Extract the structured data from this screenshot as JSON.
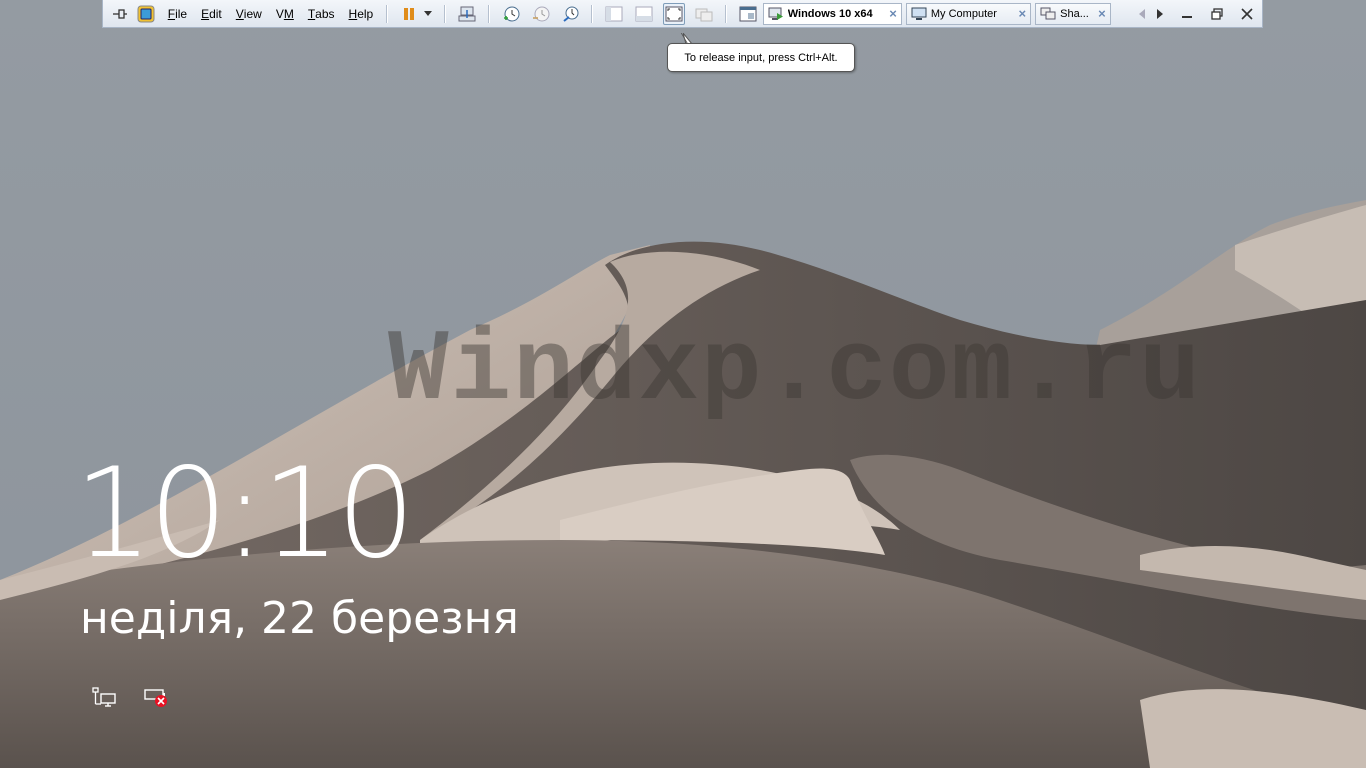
{
  "vm_menu": {
    "items": [
      {
        "label": "File",
        "mnemonic": "F",
        "rest": "ile"
      },
      {
        "label": "Edit",
        "mnemonic": "E",
        "rest": "dit"
      },
      {
        "label": "View",
        "mnemonic": "V",
        "rest": "iew"
      },
      {
        "label": "VM",
        "mnemonic": "M",
        "rest": ""
      },
      {
        "label": "Tabs",
        "mnemonic": "T",
        "rest": "abs"
      },
      {
        "label": "Help",
        "mnemonic": "H",
        "rest": "elp"
      }
    ]
  },
  "tabs": [
    {
      "label": "Windows 10 x64",
      "active": true,
      "close": "×"
    },
    {
      "label": "My Computer",
      "active": false,
      "close": "×"
    },
    {
      "label": "Sha...",
      "active": false,
      "close": "×"
    }
  ],
  "tooltip": {
    "text": "To release input, press Ctrl+Alt."
  },
  "lockscreen": {
    "time": "10:10",
    "date": "неділя, 22 березня"
  },
  "watermark": {
    "text": "Windxp.com.ru"
  },
  "colors": {
    "sky": "#9199a1",
    "dune_light": "#c8bcb2",
    "dune_shadow": "#6d6560",
    "accent_orange": "#e08c1a",
    "text": "#ffffff"
  },
  "icons": [
    "pin-icon",
    "vm-icon",
    "pause-icon",
    "send-ctrl-alt-del-icon",
    "snapshot-icon",
    "revert-snapshot-icon",
    "snapshot-manager-icon",
    "show-library-icon",
    "thumbnail-bar-icon",
    "full-screen-icon",
    "unity-icon",
    "console-view-icon",
    "network-icon",
    "battery-icon"
  ]
}
